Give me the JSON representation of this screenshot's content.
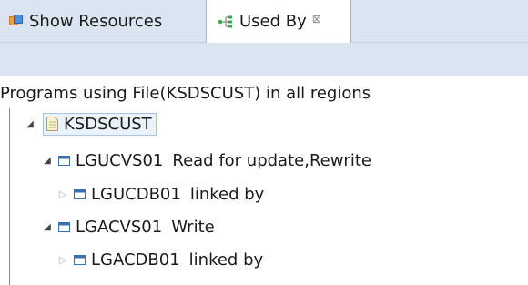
{
  "tabs": [
    {
      "label": "Show Resources",
      "icon": "resources-icon",
      "active": false
    },
    {
      "label": "Used By",
      "icon": "used-by-tree-icon",
      "active": true,
      "close_glyph": "⊠"
    }
  ],
  "view": {
    "heading": "Programs using File(KSDSCUST) in all regions"
  },
  "tree": {
    "root": {
      "label": "KSDSCUST",
      "icon": "file-document-icon",
      "expanded": true
    },
    "nodes": [
      {
        "name": "LGUCVS01",
        "detail": "Read for update,Rewrite",
        "icon": "program-icon",
        "expanded": true,
        "level": 1
      },
      {
        "name": "LGUCDB01",
        "detail": "linked by",
        "icon": "program-icon",
        "expanded": false,
        "level": 2
      },
      {
        "name": "LGACVS01",
        "detail": "Write",
        "icon": "program-icon",
        "expanded": true,
        "level": 1
      },
      {
        "name": "LGACDB01",
        "detail": "linked by",
        "icon": "program-icon",
        "expanded": false,
        "level": 2
      }
    ]
  },
  "colors": {
    "tabbar": "#dbe5f1",
    "selection": "#eaf2fb",
    "program_icon": "#3a6fb0"
  }
}
